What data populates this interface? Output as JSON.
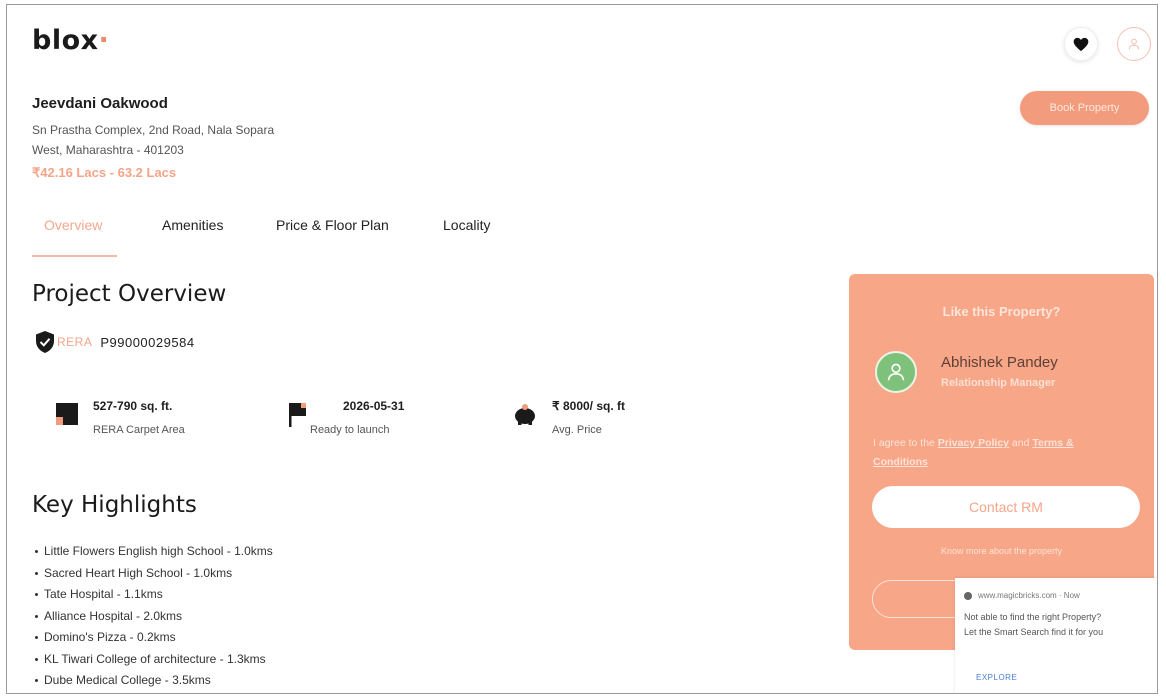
{
  "brand": {
    "name": "blox",
    "dot": "·"
  },
  "header": {
    "favorite_icon": "heart-icon",
    "profile_icon": "user-icon"
  },
  "project": {
    "name": "Jeevdani Oakwood",
    "address_line1": "Sn Prastha Complex, 2nd Road, Nala Sopara",
    "address_line2": "West, Maharashtra - 401203",
    "price_range": "₹42.16 Lacs - 63.2 Lacs",
    "book_button": "Book Property"
  },
  "tabs": [
    {
      "label": "Overview",
      "active": true
    },
    {
      "label": "Amenities",
      "active": false
    },
    {
      "label": "Price & Floor Plan",
      "active": false
    },
    {
      "label": "Locality",
      "active": false
    }
  ],
  "overview": {
    "title": "Project Overview",
    "rera_label": "RERA",
    "rera_number": "P99000029584",
    "stats": [
      {
        "value": "527-790 sq. ft.",
        "label": "RERA Carpet Area",
        "icon": "area-icon"
      },
      {
        "value": "2026-05-31",
        "label": "Ready to launch",
        "icon": "flag-icon"
      },
      {
        "value": "₹ 8000/ sq. ft",
        "label": "Avg. Price",
        "icon": "piggy-bank-icon"
      }
    ]
  },
  "highlights": {
    "title": "Key Highlights",
    "items": [
      "Little Flowers English high School - 1.0kms",
      "Sacred Heart High School - 1.0kms",
      "Tate Hospital - 1.1kms",
      "Alliance Hospital - 2.0kms",
      "Domino's Pizza - 0.2kms",
      "KL Tiwari College of architecture - 1.3kms",
      "Dube Medical College - 3.5kms"
    ]
  },
  "rm_card": {
    "title": "Like this Property?",
    "name": "Abhishek Pandey",
    "role": "Relationship Manager",
    "consent_prefix": "I agree to the ",
    "privacy_link": "Privacy Policy",
    "consent_and": " and ",
    "terms_link": "Terms & Conditions",
    "contact_button": "Contact RM",
    "know_more": "Know more about the property"
  },
  "ad_popup": {
    "source": "www.magicbricks.com · Now",
    "message_line1": "Not able to find the right Property?",
    "message_line2": "Let the Smart Search find it for you",
    "cta": "EXPLORE"
  },
  "colors": {
    "accent": "#f39c7d",
    "card": "#f7a687",
    "text": "#222222"
  }
}
